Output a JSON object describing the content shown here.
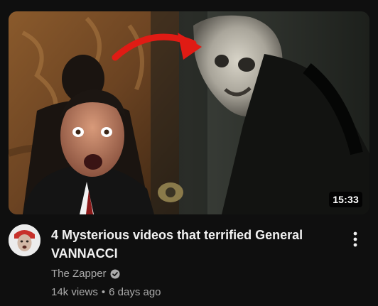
{
  "video": {
    "duration": "15:33",
    "title": "4 Mysterious videos that terrified General VANNACCI",
    "channel": "The Zapper",
    "views": "14k views",
    "separator": "•",
    "age": "6 days ago"
  },
  "icons": {
    "verified": "verified-check-icon",
    "menu": "more-vertical-icon"
  },
  "colors": {
    "background": "#0f0f0f",
    "title": "#f1f1f1",
    "secondary_text": "#aaaaaa",
    "arrow": "#e01b14"
  }
}
